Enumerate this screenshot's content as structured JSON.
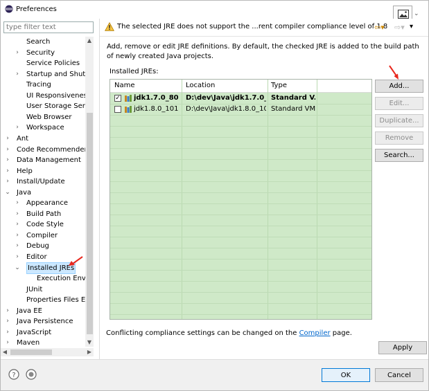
{
  "window": {
    "title": "Preferences"
  },
  "filter": {
    "placeholder": "type filter text"
  },
  "tree": [
    {
      "label": "Search",
      "indent": 2,
      "chevron": ""
    },
    {
      "label": "Security",
      "indent": 2,
      "chevron": ">"
    },
    {
      "label": "Service Policies",
      "indent": 2,
      "chevron": ""
    },
    {
      "label": "Startup and Shutd",
      "indent": 2,
      "chevron": ">"
    },
    {
      "label": "Tracing",
      "indent": 2,
      "chevron": ""
    },
    {
      "label": "UI Responsiveness",
      "indent": 2,
      "chevron": ""
    },
    {
      "label": "User Storage Serv",
      "indent": 2,
      "chevron": ""
    },
    {
      "label": "Web Browser",
      "indent": 2,
      "chevron": ""
    },
    {
      "label": "Workspace",
      "indent": 2,
      "chevron": ">"
    },
    {
      "label": "Ant",
      "indent": 1,
      "chevron": ">"
    },
    {
      "label": "Code Recommenders",
      "indent": 1,
      "chevron": ">"
    },
    {
      "label": "Data Management",
      "indent": 1,
      "chevron": ">"
    },
    {
      "label": "Help",
      "indent": 1,
      "chevron": ">"
    },
    {
      "label": "Install/Update",
      "indent": 1,
      "chevron": ">"
    },
    {
      "label": "Java",
      "indent": 1,
      "chevron": "v"
    },
    {
      "label": "Appearance",
      "indent": 2,
      "chevron": ">"
    },
    {
      "label": "Build Path",
      "indent": 2,
      "chevron": ">"
    },
    {
      "label": "Code Style",
      "indent": 2,
      "chevron": ">"
    },
    {
      "label": "Compiler",
      "indent": 2,
      "chevron": ">"
    },
    {
      "label": "Debug",
      "indent": 2,
      "chevron": ">"
    },
    {
      "label": "Editor",
      "indent": 2,
      "chevron": ">"
    },
    {
      "label": "Installed JREs",
      "indent": 2,
      "chevron": "v",
      "selected": true
    },
    {
      "label": "Execution Envir",
      "indent": 3,
      "chevron": ""
    },
    {
      "label": "JUnit",
      "indent": 2,
      "chevron": ""
    },
    {
      "label": "Properties Files Ed",
      "indent": 2,
      "chevron": ""
    },
    {
      "label": "Java EE",
      "indent": 1,
      "chevron": ">"
    },
    {
      "label": "Java Persistence",
      "indent": 1,
      "chevron": ">"
    },
    {
      "label": "JavaScript",
      "indent": 1,
      "chevron": ">"
    },
    {
      "label": "Maven",
      "indent": 1,
      "chevron": ">"
    }
  ],
  "header": {
    "warning": "The selected JRE does not support the ...rent compiler compliance level of 1.8"
  },
  "description": "Add, remove or edit JRE definitions. By default, the checked JRE is added to the build path of newly created Java projects.",
  "installed_label": "Installed JREs:",
  "table": {
    "columns": [
      "Name",
      "Location",
      "Type"
    ],
    "rows": [
      {
        "name": "jdk1.7.0_80 (...",
        "location": "D:\\dev\\Java\\jdk1.7.0_...",
        "type": "Standard V...",
        "checked": true,
        "bold": true
      },
      {
        "name": "jdk1.8.0_101",
        "location": "D:\\dev\\Java\\jdk1.8.0_101",
        "type": "Standard VM",
        "checked": false,
        "bold": false
      }
    ]
  },
  "buttons": {
    "add": "Add...",
    "edit": "Edit...",
    "duplicate": "Duplicate...",
    "remove": "Remove",
    "search": "Search...",
    "apply": "Apply",
    "ok": "OK",
    "cancel": "Cancel"
  },
  "conflict": {
    "before": "Conflicting compliance settings can be changed on the ",
    "link": "Compiler",
    "after": " page."
  },
  "colors": {
    "table_bg": "#cfe9c8",
    "selection": "#cce8ff",
    "link": "#0066cc",
    "arrow": "#e8281e"
  },
  "icons": [
    "eclipse-icon",
    "warning-icon",
    "back-icon",
    "forward-icon",
    "menu-icon",
    "jre-library-icon",
    "help-icon",
    "record-icon",
    "image-icon"
  ]
}
